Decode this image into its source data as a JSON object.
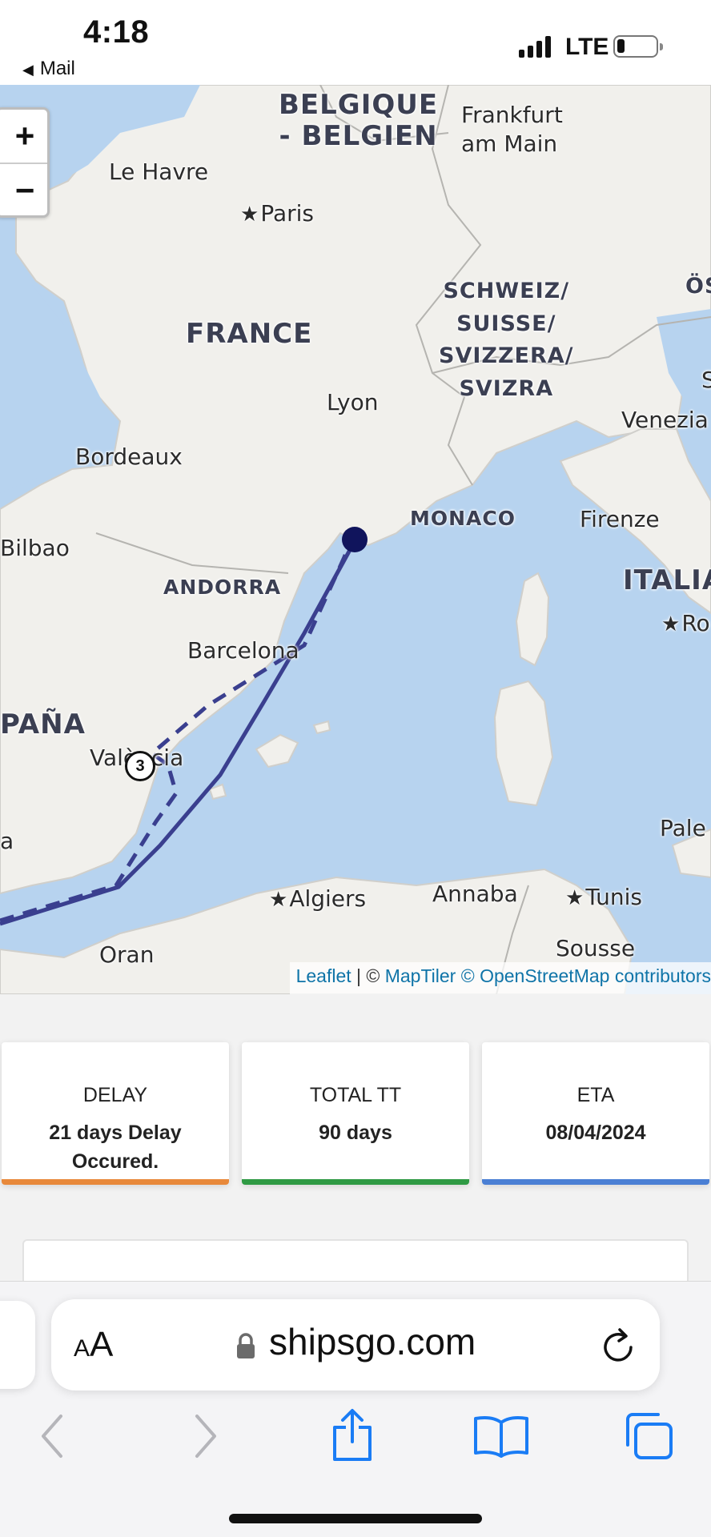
{
  "status_bar": {
    "time": "4:18",
    "back_app": "Mail",
    "network": "LTE",
    "battery_level": 0.2
  },
  "map": {
    "zoom_in": "+",
    "zoom_out": "−",
    "countries": {
      "belgique_line1": "BELGIQUE",
      "belgique_line2": "- BELGIEN",
      "france": "FRANCE",
      "schweiz_line1": "SCHWEIZ/",
      "schweiz_line2": "SUISSE/",
      "schweiz_line3": "SVIZZERA/",
      "schweiz_line4": "SVIZRA",
      "monaco": "MONACO",
      "andorra": "ANDORRA",
      "italia": "ITALIA",
      "espana": "PAÑA",
      "osterreich": "ÖS"
    },
    "cities": {
      "frankfurt_line1": "Frankfurt",
      "frankfurt_line2": "am Main",
      "le_havre": "Le Havre",
      "paris": "Paris",
      "lyon": "Lyon",
      "venezia": "Venezia",
      "bordeaux": "Bordeaux",
      "firenze": "Firenze",
      "bilbao": "Bilbao",
      "barcelona": "Barcelona",
      "roma": "Ro",
      "valencia": "València",
      "palermo": "Pale",
      "algiers": "Algiers",
      "annaba": "Annaba",
      "tunis": "Tunis",
      "oran": "Oran",
      "sousse": "Sousse",
      "edge_a": "a",
      "edge_s": "S"
    },
    "stop_marker": "3",
    "attribution": {
      "leaflet": "Leaflet",
      "sep": " | © ",
      "maptiler": "MapTiler",
      "osm": "© OpenStreetMap contributors"
    }
  },
  "cards": [
    {
      "title": "DELAY",
      "value": "21 days Delay Occured.",
      "color": "#e8893b"
    },
    {
      "title": "TOTAL TT",
      "value": "90 days",
      "color": "#2f9a44"
    },
    {
      "title": "ETA",
      "value": "08/04/2024",
      "color": "#4a7fd4"
    }
  ],
  "browser": {
    "text_size_label_small": "A",
    "text_size_label_large": "A",
    "url": "shipsgo.com"
  },
  "colors": {
    "sea": "#b7d3ef",
    "land": "#f1f0ec",
    "route": "#3a3f8f",
    "ios_blue": "#1a7cf5"
  }
}
